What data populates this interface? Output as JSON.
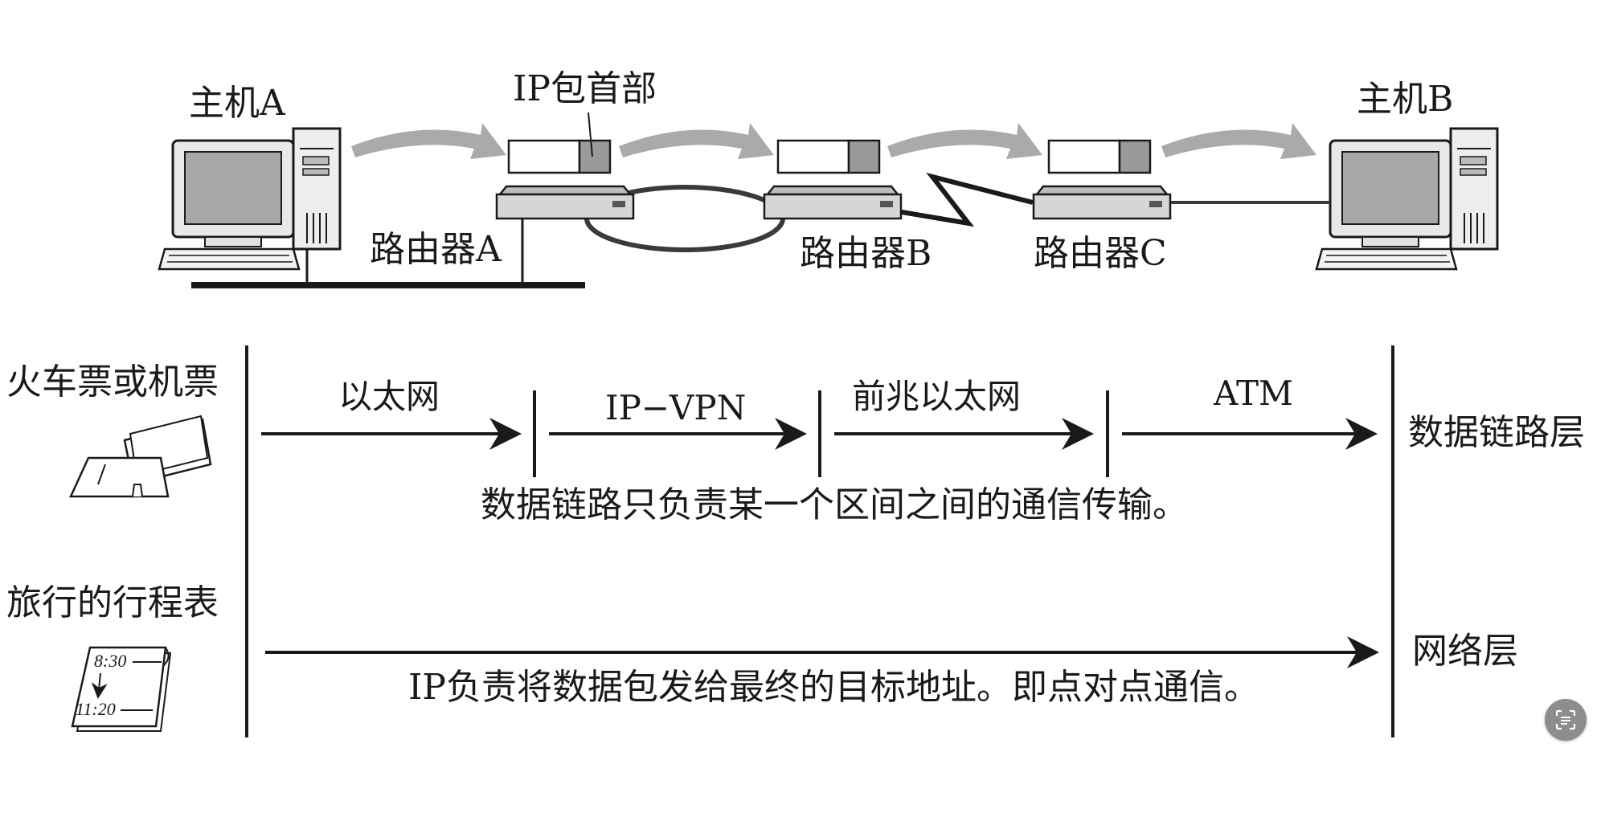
{
  "network": {
    "host_a_label": "主机A",
    "host_b_label": "主机B",
    "router_a_label": "路由器A",
    "router_b_label": "路由器B",
    "router_c_label": "路由器C",
    "ip_header_label": "IP包首部"
  },
  "datalink": {
    "analogy_label": "火车票或机票",
    "segments": [
      "以太网",
      "IP−VPN",
      "前兆以太网",
      "ATM"
    ],
    "layer_label": "数据链路层",
    "description": "数据链路只负责某一个区间之间的通信传输。"
  },
  "network_layer": {
    "analogy_label": "旅行的行程表",
    "schedule_times": [
      "8:30",
      "11:20"
    ],
    "layer_label": "网络层",
    "description": "IP负责将数据包发给最终的目标地址。即点对点通信。"
  },
  "colors": {
    "ink": "#1a1a1a",
    "flow_arrow": "#aaaaaa",
    "header_fill": "#9a9a9a",
    "device_fill": "#d6d6d6",
    "screen_fill": "#a8a8a8"
  },
  "icons": {
    "scan_button": "text-scan-icon"
  }
}
